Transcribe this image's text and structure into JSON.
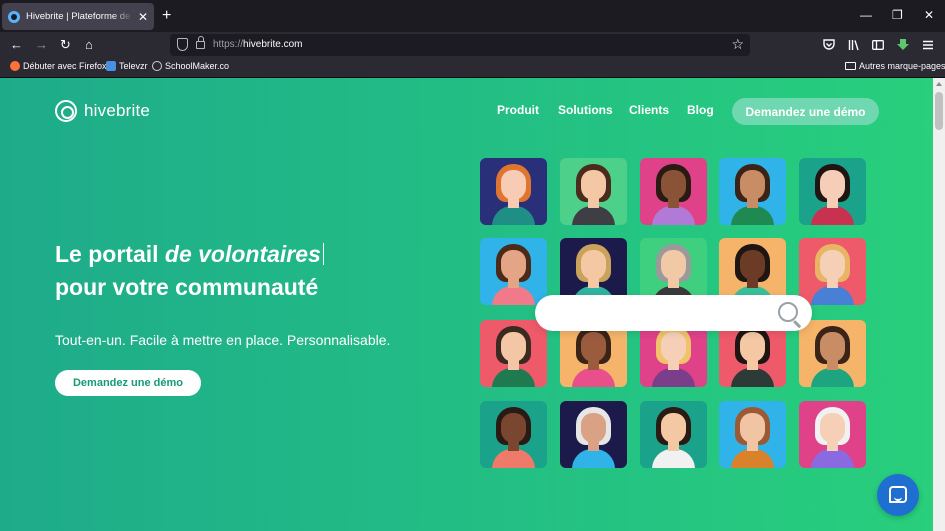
{
  "browser": {
    "tab_title": "Hivebrite | Plateforme de gestion",
    "tab_close": "✕",
    "new_tab": "+",
    "window_controls": {
      "minimize": "—",
      "restore": "❐",
      "close": "✕"
    },
    "nav": {
      "back": "←",
      "forward": "→",
      "reload": "↻",
      "home": "⌂"
    },
    "url_scheme": "https://",
    "url_host": "hivebrite.com",
    "bookmark_star": "☆",
    "toolbar_icons": [
      "pocket-icon",
      "library-icon",
      "sidebar-icon",
      "extension-icon",
      "menu-icon"
    ],
    "bookmarks": [
      {
        "label": "Débuter avec Firefox",
        "icon": "firefox-icon",
        "color": "#ff7139"
      },
      {
        "label": "Televzr",
        "icon": "televzr-icon",
        "color": "#4a90e2"
      },
      {
        "label": "SchoolMaker.co",
        "icon": "globe-icon",
        "color": "#cfcfd8"
      }
    ],
    "other_bookmarks": "Autres marque-pages"
  },
  "site": {
    "logo_text": "hivebrite",
    "menu": [
      "Produit",
      "Solutions",
      "Clients",
      "Blog"
    ],
    "demo_button": "Demandez une démo",
    "hero": {
      "line1_prefix": "Le portail ",
      "line1_emphasis": "de volontaires",
      "line2": "pour votre communauté",
      "subtitle": "Tout-en-un. Facile à mettre en place. Personnalisable.",
      "cta": "Demandez une démo"
    },
    "chat_icon": "chat-icon",
    "colors": {
      "accent": "#23bf84",
      "demo_top_bg": "#6fd8b0",
      "cta_text": "#169a78",
      "chat": "#1f6fd1"
    },
    "avatars": [
      {
        "bg": "#2a2f7a",
        "hair": "#e0752f",
        "skin": "#f7cbb4",
        "shirt": "#1f8f86"
      },
      {
        "bg": "#4dd08a",
        "hair": "#4a2b1d",
        "skin": "#f4c7a5",
        "shirt": "#3e3e44"
      },
      {
        "bg": "#e0428a",
        "hair": "#2a1a14",
        "skin": "#8a5237",
        "shirt": "#b07ad6"
      },
      {
        "bg": "#2fb3e8",
        "hair": "#3b2417",
        "skin": "#c98d66",
        "shirt": "#1e8a52"
      },
      {
        "bg": "#1aa38a",
        "hair": "#1f1512",
        "skin": "#f6cdb6",
        "shirt": "#c93150"
      },
      {
        "bg": "#2fb3e8",
        "hair": "#4b2a1a",
        "skin": "#e4a486",
        "shirt": "#f07a8a"
      },
      {
        "bg": "#1c1a4a",
        "hair": "#c9a25c",
        "skin": "#f3c8a3",
        "shirt": "#2fb3a1"
      },
      {
        "bg": "#3fd07f",
        "hair": "#9a9a9a",
        "skin": "#f1c9a7",
        "shirt": "#3a3a3a"
      },
      {
        "bg": "#f5b46a",
        "hair": "#1f1512",
        "skin": "#6b3b25",
        "shirt": "#3abf9a"
      },
      {
        "bg": "#ef5a6b",
        "hair": "#e8b565",
        "skin": "#f6cfb7",
        "shirt": "#4a7fd6"
      },
      {
        "bg": "#ef5a6b",
        "hair": "#3b2a20",
        "skin": "#f3c6a6",
        "shirt": "#1f7a4f"
      },
      {
        "bg": "#f5b46a",
        "hair": "#3a2418",
        "skin": "#9b5c3e",
        "shirt": "#e94f8a"
      },
      {
        "bg": "#e0428a",
        "hair": "#f0c36a",
        "skin": "#f6cfb7",
        "shirt": "#7a3e8a"
      },
      {
        "bg": "#ef5a6b",
        "hair": "#1f1512",
        "skin": "#f3c8a3",
        "shirt": "#2c3a38"
      },
      {
        "bg": "#f5b46a",
        "hair": "#3b2417",
        "skin": "#c98d66",
        "shirt": "#1ea47e"
      },
      {
        "bg": "#1aa38a",
        "hair": "#2a1a14",
        "skin": "#7a4630",
        "shirt": "#ef7a6a"
      },
      {
        "bg": "#1c1a4a",
        "hair": "#e6e6e6",
        "skin": "#d9a284",
        "shirt": "#2fb3e8"
      },
      {
        "bg": "#1aa38a",
        "hair": "#2a1a14",
        "skin": "#f3c8a3",
        "shirt": "#f1f1f1"
      },
      {
        "bg": "#2fb3e8",
        "hair": "#9b5a34",
        "skin": "#f1c4a3",
        "shirt": "#d9822b"
      },
      {
        "bg": "#e0428a",
        "hair": "#f1f1f1",
        "skin": "#f6cfb7",
        "shirt": "#8a6ae0"
      }
    ]
  }
}
